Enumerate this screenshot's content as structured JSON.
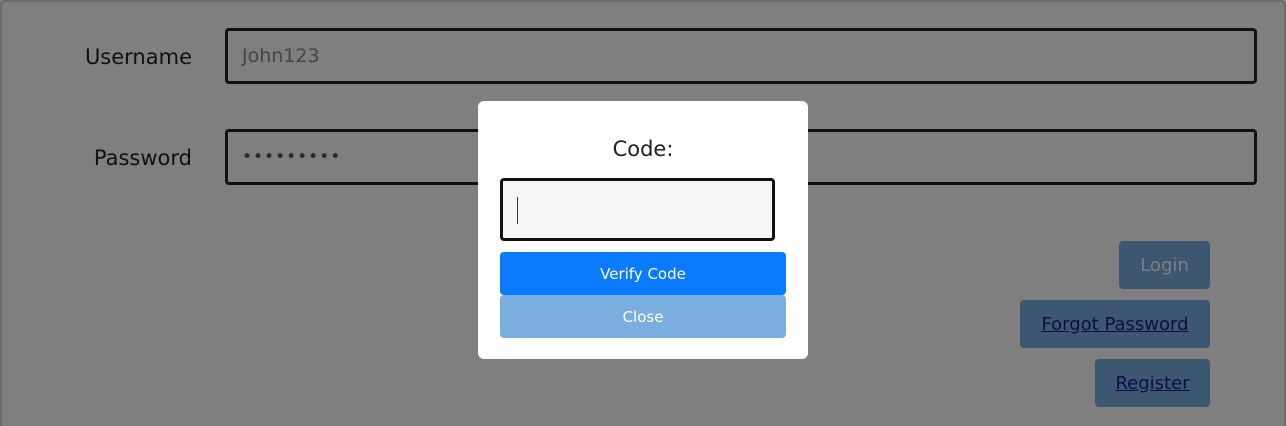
{
  "login_form": {
    "username_label": "Username",
    "username_value": "John123",
    "password_label": "Password",
    "password_value": "•••••••••",
    "login_label": "Login",
    "forgot_password_label": "Forgot Password",
    "register_label": "Register"
  },
  "modal": {
    "title": "Code:",
    "code_value": "",
    "verify_label": "Verify Code",
    "close_label": "Close"
  },
  "colors": {
    "primary": "#0a7aff",
    "disabled_primary": "#7aaedf",
    "overlay": "rgba(0,0,0,0.5)"
  }
}
